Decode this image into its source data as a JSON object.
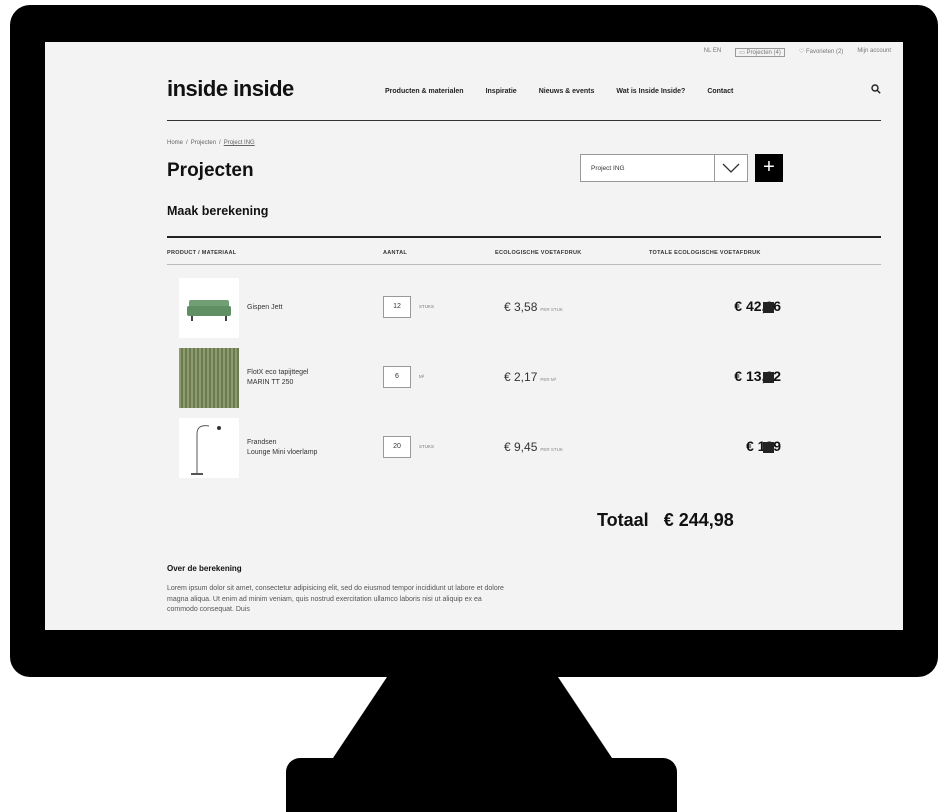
{
  "utility_bar": {
    "language": "NL EN",
    "projects": "Projecten (4)",
    "favorites": "Favorieten (2)",
    "account": "Mijn account"
  },
  "header": {
    "logo": "inside inside",
    "nav": [
      "Producten & materialen",
      "Inspiratie",
      "Nieuws & events",
      "Wat is Inside Inside?",
      "Contact"
    ]
  },
  "breadcrumb": {
    "home": "Home",
    "projects": "Projecten",
    "current": "Project ING",
    "sep": "/"
  },
  "page_title": "Projecten",
  "project_select": {
    "value": "Project ING"
  },
  "section_title": "Maak berekening",
  "table": {
    "headers": [
      "PRODUCT / MATERIAAL",
      "AANTAL",
      "ECOLOGISCHE VOETAFDRUK",
      "TOTALE ECOLOGISCHE VOETAFDRUK"
    ],
    "rows": [
      {
        "name_line1": "Gispen Jett",
        "name_line2": "",
        "quantity": "12",
        "unit": "STUKS",
        "price": "€ 3,58",
        "per": "PER STUK",
        "total": "€ 42,96"
      },
      {
        "name_line1": "FlotX eco tapijttegel",
        "name_line2": "MARIN TT 250",
        "quantity": "6",
        "unit": "M²",
        "price": "€ 2,17",
        "per": "PER M²",
        "total": "€ 13,02"
      },
      {
        "name_line1": "Frandsen",
        "name_line2": "Lounge Mini vloerlamp",
        "quantity": "20",
        "unit": "STUKS",
        "price": "€ 9,45",
        "per": "PER STUK",
        "total": "€ 189"
      }
    ]
  },
  "grand_total": {
    "label": "Totaal",
    "value": "€ 244,98"
  },
  "about": {
    "title": "Over de berekening",
    "text": "Lorem ipsum dolor sit amet, consectetur adipisicing elit, sed do eiusmod tempor incididunt ut labore et dolore magna aliqua. Ut enim ad minim veniam, quis nostrud exercitation ullamco laboris nisi ut aliquip ex ea commodo consequat. Duis"
  },
  "colors": {
    "screen_bg": "#f3f3f3",
    "sofa_green": "#6f9f73",
    "carpet_green": "#7a8a5c"
  },
  "icons": [
    "search-icon",
    "folder-icon",
    "heart-icon",
    "chevron-down-icon",
    "plus-icon"
  ]
}
